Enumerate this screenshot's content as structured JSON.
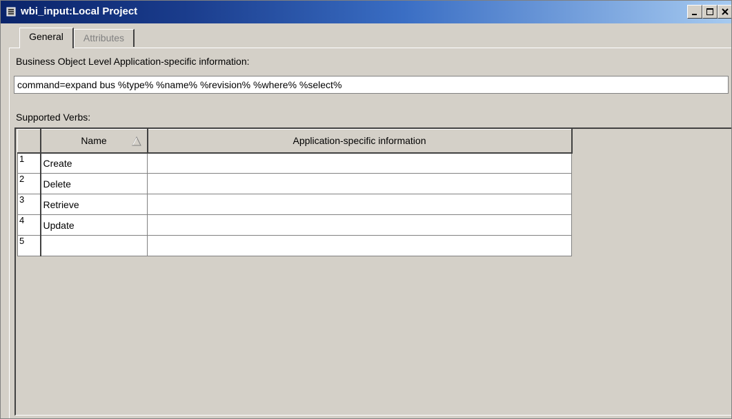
{
  "window": {
    "title": "wbi_input:Local Project"
  },
  "tabs": [
    {
      "label": "General",
      "active": true
    },
    {
      "label": "Attributes",
      "active": false
    }
  ],
  "business_object": {
    "label": "Business Object Level Application-specific information:",
    "value": "command=expand bus %type% %name% %revision% %where% %select%"
  },
  "verbs": {
    "label": "Supported Verbs:",
    "columns": {
      "name": "Name",
      "info": "Application-specific information"
    },
    "rows": [
      {
        "num": "1",
        "name": "Create",
        "info": ""
      },
      {
        "num": "2",
        "name": "Delete",
        "info": ""
      },
      {
        "num": "3",
        "name": "Retrieve",
        "info": ""
      },
      {
        "num": "4",
        "name": "Update",
        "info": ""
      },
      {
        "num": "5",
        "name": "",
        "info": ""
      }
    ]
  },
  "colors": {
    "titlebar_start": "#0a246a",
    "titlebar_end": "#a6caf0",
    "face": "#d4d0c8"
  }
}
